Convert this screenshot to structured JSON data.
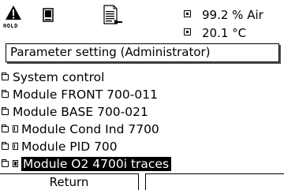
{
  "status": {
    "hold_label": "HOLD",
    "measurements": [
      {
        "value": "99.2 % Air"
      },
      {
        "value": "20.1 °C"
      }
    ]
  },
  "header": {
    "title": "Parameter setting (Administrator)"
  },
  "menu": {
    "items": [
      {
        "label": "System control",
        "icon": "folder-icon"
      },
      {
        "label": "Module FRONT 700-011",
        "icon": "folder-icon"
      },
      {
        "label": "Module BASE 700-021",
        "icon": "folder-icon"
      },
      {
        "label": "Module Cond Ind 7700",
        "icon": "folder-icon",
        "module_icon": "module-grid-icon"
      },
      {
        "label": "Module PID 700",
        "icon": "folder-icon",
        "module_icon": "module-grid-icon"
      },
      {
        "label": "Module O2 4700i traces",
        "icon": "folder-icon",
        "module_icon": "module-filled-icon",
        "selected": true
      }
    ]
  },
  "footer": {
    "return_label": "Return"
  }
}
